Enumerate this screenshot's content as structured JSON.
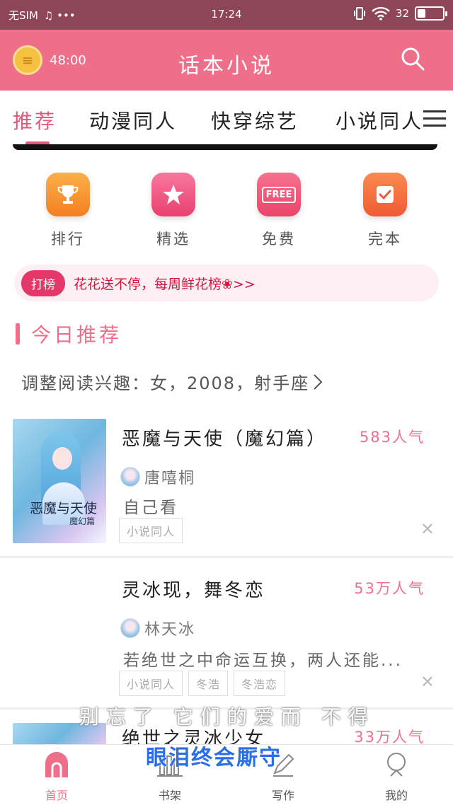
{
  "status_bar": {
    "carrier": "无SIM",
    "extra": "♫ •••",
    "time": "17:24",
    "battery_text": "32",
    "battery_level": 0.32
  },
  "header": {
    "timer": "48:00",
    "title": "话本小说"
  },
  "tabs": [
    {
      "label": "推荐"
    },
    {
      "label": "动漫同人"
    },
    {
      "label": "快穿综艺"
    },
    {
      "label": "小说同人"
    }
  ],
  "quick_entries": [
    {
      "label": "排行",
      "icon": "trophy-icon",
      "color": "#f7922f"
    },
    {
      "label": "精选",
      "icon": "star-icon",
      "color": "#f05a86"
    },
    {
      "label": "免费",
      "icon": "free-icon",
      "icon_text": "FREE",
      "color": "#ef5b7c"
    },
    {
      "label": "完本",
      "icon": "check-icon",
      "color": "#f4693f"
    }
  ],
  "promo": {
    "badge": "打榜",
    "text": "花花送不停，每周鲜花榜❀>>"
  },
  "section": {
    "title": "今日推荐",
    "interest": "调整阅读兴趣：女，2008，射手座"
  },
  "books": [
    {
      "title": "恶魔与天使（魔幻篇）",
      "popularity": "583人气",
      "author": "唐嘻桐",
      "description": "自己看",
      "tags": [
        "小说同人"
      ],
      "cover_text": "恶魔与天使",
      "cover_subtext": "魔幻篇"
    },
    {
      "title": "灵冰现，舞冬恋",
      "popularity": "53万人气",
      "author": "林天冰",
      "description": "若绝世之中命运互换，两人还能...",
      "tags": [
        "小说同人",
        "冬浩",
        "冬浩恋"
      ]
    },
    {
      "title": "绝世之灵冰少女",
      "popularity": "33万人气"
    }
  ],
  "overlay": {
    "line1": "别忘了 它们的爱而 不得",
    "line2": "眼泪终会厮守"
  },
  "bottom_nav": [
    {
      "label": "首页",
      "icon": "home-icon"
    },
    {
      "label": "书架",
      "icon": "bookshelf-icon"
    },
    {
      "label": "写作",
      "icon": "write-icon"
    },
    {
      "label": "我的",
      "icon": "profile-icon"
    }
  ],
  "colors": {
    "accent": "#ef6f8b",
    "status_bar": "#8f4558",
    "promo_text": "#d2163d"
  }
}
